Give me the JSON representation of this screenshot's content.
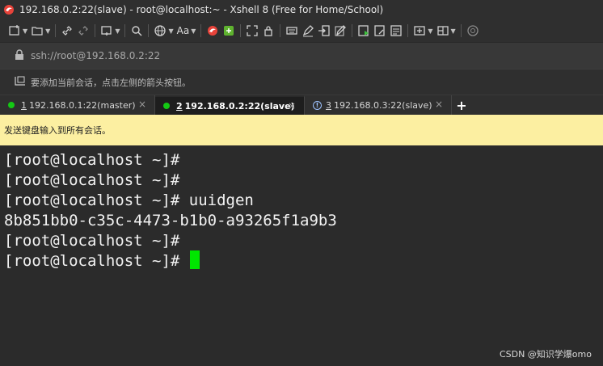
{
  "window": {
    "title": "192.168.0.2:22(slave) - root@localhost:~ - Xshell 8 (Free for Home/School)"
  },
  "toolbar": {
    "font_label": "Aa"
  },
  "address": {
    "url": "ssh://root@192.168.0.2:22"
  },
  "hint": {
    "text": "要添加当前会话，点击左侧的箭头按钮。"
  },
  "tabs": [
    {
      "num": "1",
      "label": "192.168.0.1:22(master)",
      "status": "connected"
    },
    {
      "num": "2",
      "label": "192.168.0.2:22(slave)",
      "status": "connected",
      "active": true
    },
    {
      "num": "3",
      "label": "192.168.0.3:22(slave)",
      "status": "info"
    }
  ],
  "tab_close": "×",
  "tab_add": "+",
  "send_bar": {
    "text": "发送键盘输入到所有会话。"
  },
  "terminal": {
    "lines": [
      "[root@localhost ~]#",
      "[root@localhost ~]#",
      "[root@localhost ~]# uuidgen",
      "8b851bb0-c35c-4473-b1b0-a93265f1a9b3",
      "[root@localhost ~]#",
      "[root@localhost ~]# "
    ]
  },
  "watermark": {
    "text": "CSDN @知识学爆omo"
  },
  "colors": {
    "cursor": "#00e600",
    "send_bar_bg": "#fcefa1",
    "status_dot": "#14c814"
  }
}
